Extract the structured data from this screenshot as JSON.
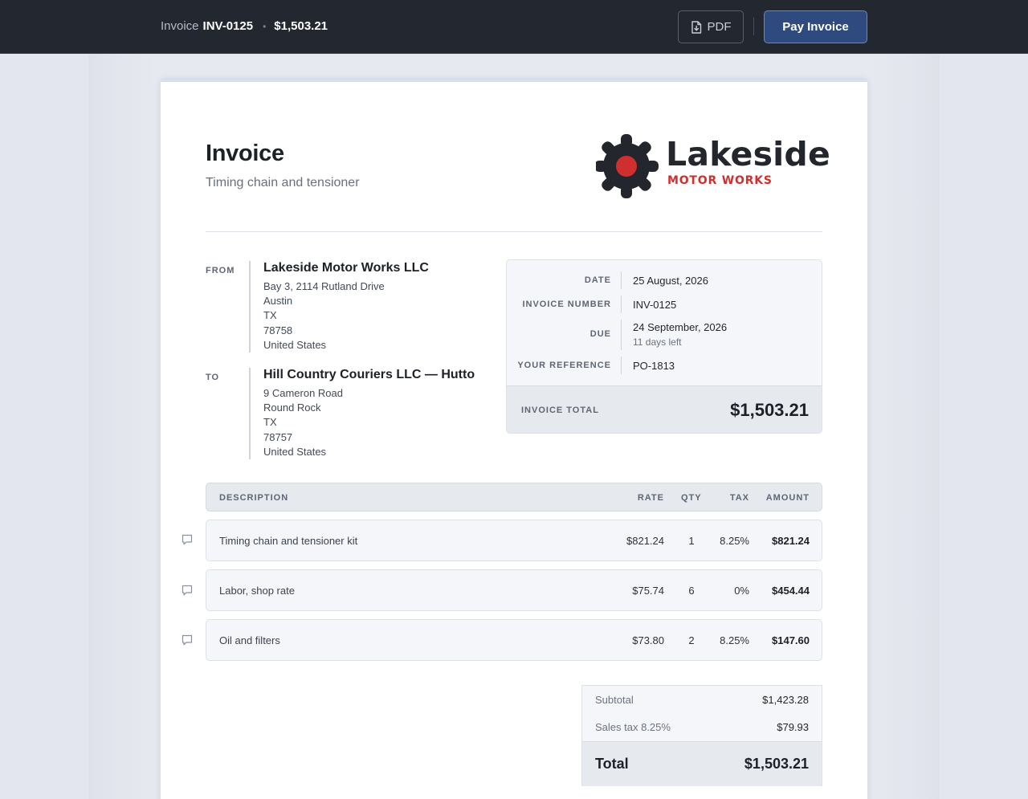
{
  "topbar": {
    "invoice_label": "Invoice",
    "invoice_number": "INV-0125",
    "separator": "•",
    "amount": "$1,503.21",
    "pdf_label": "PDF",
    "pay_label": "Pay Invoice",
    "pdf_icon": "file-download-icon"
  },
  "invoice": {
    "title": "Invoice",
    "subtitle": "Timing chain and tensioner"
  },
  "logo": {
    "name": "Lakeside",
    "tagline": "MOTOR WORKS",
    "icon": "gear-icon",
    "colors": {
      "dark": "#23262d",
      "accent": "#cf2f2f"
    }
  },
  "from": {
    "label": "FROM",
    "name": "Lakeside Motor Works LLC",
    "lines": [
      "Bay 3, 2114 Rutland Drive",
      "Austin",
      "TX",
      "78758",
      "United States"
    ]
  },
  "to": {
    "label": "TO",
    "name": "Hill Country Couriers LLC — Hutto",
    "lines": [
      "9 Cameron Road",
      "Round Rock",
      "TX",
      "78757",
      "United States"
    ]
  },
  "meta": {
    "date_label": "DATE",
    "date": "25 August, 2026",
    "number_label": "INVOICE NUMBER",
    "number": "INV-0125",
    "due_label": "DUE",
    "due": "24 September, 2026",
    "due_note": "11 days left",
    "reference_label": "YOUR REFERENCE",
    "reference": "PO-1813",
    "total_label": "INVOICE TOTAL",
    "total": "$1,503.21"
  },
  "table": {
    "headers": {
      "description": "DESCRIPTION",
      "rate": "RATE",
      "qty": "QTY",
      "tax": "TAX",
      "amount": "AMOUNT"
    },
    "rows": [
      {
        "description": "Timing chain and tensioner kit",
        "rate": "$821.24",
        "qty": "1",
        "tax": "8.25%",
        "amount": "$821.24"
      },
      {
        "description": "Labor, shop rate",
        "rate": "$75.74",
        "qty": "6",
        "tax": "0%",
        "amount": "$454.44"
      },
      {
        "description": "Oil and filters",
        "rate": "$73.80",
        "qty": "2",
        "tax": "8.25%",
        "amount": "$147.60"
      }
    ],
    "row_icon": "comment-icon"
  },
  "totals": {
    "subtotal_label": "Subtotal",
    "subtotal": "$1,423.28",
    "tax_label": "Sales tax 8.25%",
    "tax": "$79.93",
    "total_label": "Total",
    "total": "$1,503.21"
  },
  "colors": {
    "topbar": "#232730",
    "pay_button": "#2f4a7e",
    "page_bg": "#e3e6ee"
  }
}
